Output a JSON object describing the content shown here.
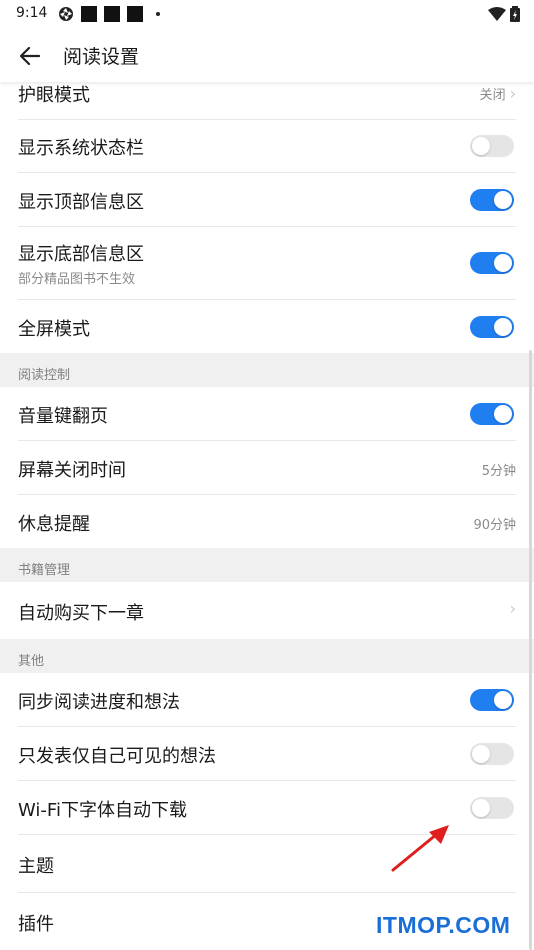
{
  "status_bar": {
    "time": "9:14"
  },
  "header": {
    "title": "阅读设置"
  },
  "items": {
    "eye_mode": {
      "label": "护眼模式",
      "value": "关闭"
    },
    "system_status": {
      "label": "显示系统状态栏",
      "on": false
    },
    "top_info": {
      "label": "显示顶部信息区",
      "on": true
    },
    "bottom_info": {
      "label": "显示底部信息区",
      "sublabel": "部分精品图书不生效",
      "on": true
    },
    "fullscreen": {
      "label": "全屏模式",
      "on": true
    },
    "volume_flip": {
      "label": "音量键翻页",
      "on": true
    },
    "screen_off": {
      "label": "屏幕关闭时间",
      "value": "5分钟"
    },
    "rest_remind": {
      "label": "休息提醒",
      "value": "90分钟"
    },
    "auto_buy": {
      "label": "自动购买下一章"
    },
    "sync_progress": {
      "label": "同步阅读进度和想法",
      "on": true
    },
    "private_notes": {
      "label": "只发表仅自己可见的想法",
      "on": false
    },
    "wifi_font": {
      "label": "Wi-Fi下字体自动下载",
      "on": false
    },
    "theme": {
      "label": "主题"
    },
    "plugins": {
      "label": "插件"
    }
  },
  "sections": {
    "reading_control": "阅读控制",
    "book_management": "书籍管理",
    "other": "其他"
  },
  "watermark": "ITMOP.COM",
  "colors": {
    "accent": "#1f7ef0",
    "toggle_off": "#e5e5e5",
    "section_bg": "#f0f0f0",
    "arrow": "#e01e1e"
  }
}
